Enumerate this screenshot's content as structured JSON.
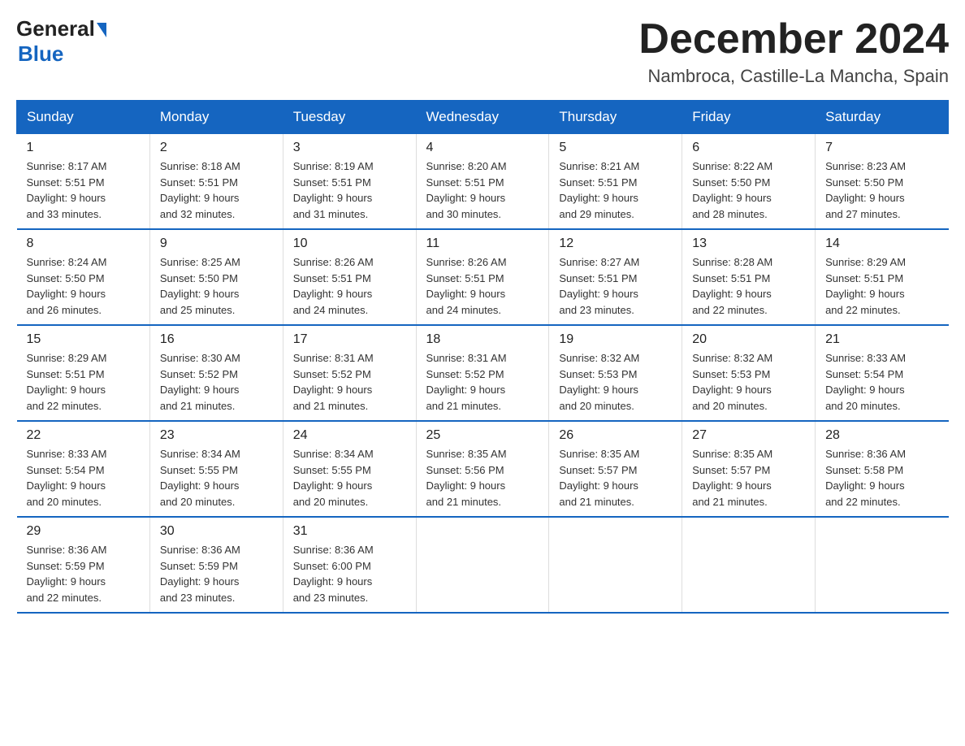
{
  "logo": {
    "general": "General",
    "blue": "Blue"
  },
  "title": {
    "month": "December 2024",
    "location": "Nambroca, Castille-La Mancha, Spain"
  },
  "header": {
    "days": [
      "Sunday",
      "Monday",
      "Tuesday",
      "Wednesday",
      "Thursday",
      "Friday",
      "Saturday"
    ]
  },
  "weeks": [
    [
      {
        "day": "1",
        "sunrise": "8:17 AM",
        "sunset": "5:51 PM",
        "daylight": "9 hours and 33 minutes."
      },
      {
        "day": "2",
        "sunrise": "8:18 AM",
        "sunset": "5:51 PM",
        "daylight": "9 hours and 32 minutes."
      },
      {
        "day": "3",
        "sunrise": "8:19 AM",
        "sunset": "5:51 PM",
        "daylight": "9 hours and 31 minutes."
      },
      {
        "day": "4",
        "sunrise": "8:20 AM",
        "sunset": "5:51 PM",
        "daylight": "9 hours and 30 minutes."
      },
      {
        "day": "5",
        "sunrise": "8:21 AM",
        "sunset": "5:51 PM",
        "daylight": "9 hours and 29 minutes."
      },
      {
        "day": "6",
        "sunrise": "8:22 AM",
        "sunset": "5:50 PM",
        "daylight": "9 hours and 28 minutes."
      },
      {
        "day": "7",
        "sunrise": "8:23 AM",
        "sunset": "5:50 PM",
        "daylight": "9 hours and 27 minutes."
      }
    ],
    [
      {
        "day": "8",
        "sunrise": "8:24 AM",
        "sunset": "5:50 PM",
        "daylight": "9 hours and 26 minutes."
      },
      {
        "day": "9",
        "sunrise": "8:25 AM",
        "sunset": "5:50 PM",
        "daylight": "9 hours and 25 minutes."
      },
      {
        "day": "10",
        "sunrise": "8:26 AM",
        "sunset": "5:51 PM",
        "daylight": "9 hours and 24 minutes."
      },
      {
        "day": "11",
        "sunrise": "8:26 AM",
        "sunset": "5:51 PM",
        "daylight": "9 hours and 24 minutes."
      },
      {
        "day": "12",
        "sunrise": "8:27 AM",
        "sunset": "5:51 PM",
        "daylight": "9 hours and 23 minutes."
      },
      {
        "day": "13",
        "sunrise": "8:28 AM",
        "sunset": "5:51 PM",
        "daylight": "9 hours and 22 minutes."
      },
      {
        "day": "14",
        "sunrise": "8:29 AM",
        "sunset": "5:51 PM",
        "daylight": "9 hours and 22 minutes."
      }
    ],
    [
      {
        "day": "15",
        "sunrise": "8:29 AM",
        "sunset": "5:51 PM",
        "daylight": "9 hours and 22 minutes."
      },
      {
        "day": "16",
        "sunrise": "8:30 AM",
        "sunset": "5:52 PM",
        "daylight": "9 hours and 21 minutes."
      },
      {
        "day": "17",
        "sunrise": "8:31 AM",
        "sunset": "5:52 PM",
        "daylight": "9 hours and 21 minutes."
      },
      {
        "day": "18",
        "sunrise": "8:31 AM",
        "sunset": "5:52 PM",
        "daylight": "9 hours and 21 minutes."
      },
      {
        "day": "19",
        "sunrise": "8:32 AM",
        "sunset": "5:53 PM",
        "daylight": "9 hours and 20 minutes."
      },
      {
        "day": "20",
        "sunrise": "8:32 AM",
        "sunset": "5:53 PM",
        "daylight": "9 hours and 20 minutes."
      },
      {
        "day": "21",
        "sunrise": "8:33 AM",
        "sunset": "5:54 PM",
        "daylight": "9 hours and 20 minutes."
      }
    ],
    [
      {
        "day": "22",
        "sunrise": "8:33 AM",
        "sunset": "5:54 PM",
        "daylight": "9 hours and 20 minutes."
      },
      {
        "day": "23",
        "sunrise": "8:34 AM",
        "sunset": "5:55 PM",
        "daylight": "9 hours and 20 minutes."
      },
      {
        "day": "24",
        "sunrise": "8:34 AM",
        "sunset": "5:55 PM",
        "daylight": "9 hours and 20 minutes."
      },
      {
        "day": "25",
        "sunrise": "8:35 AM",
        "sunset": "5:56 PM",
        "daylight": "9 hours and 21 minutes."
      },
      {
        "day": "26",
        "sunrise": "8:35 AM",
        "sunset": "5:57 PM",
        "daylight": "9 hours and 21 minutes."
      },
      {
        "day": "27",
        "sunrise": "8:35 AM",
        "sunset": "5:57 PM",
        "daylight": "9 hours and 21 minutes."
      },
      {
        "day": "28",
        "sunrise": "8:36 AM",
        "sunset": "5:58 PM",
        "daylight": "9 hours and 22 minutes."
      }
    ],
    [
      {
        "day": "29",
        "sunrise": "8:36 AM",
        "sunset": "5:59 PM",
        "daylight": "9 hours and 22 minutes."
      },
      {
        "day": "30",
        "sunrise": "8:36 AM",
        "sunset": "5:59 PM",
        "daylight": "9 hours and 23 minutes."
      },
      {
        "day": "31",
        "sunrise": "8:36 AM",
        "sunset": "6:00 PM",
        "daylight": "9 hours and 23 minutes."
      },
      null,
      null,
      null,
      null
    ]
  ],
  "labels": {
    "sunrise_prefix": "Sunrise: ",
    "sunset_prefix": "Sunset: ",
    "daylight_prefix": "Daylight: "
  }
}
